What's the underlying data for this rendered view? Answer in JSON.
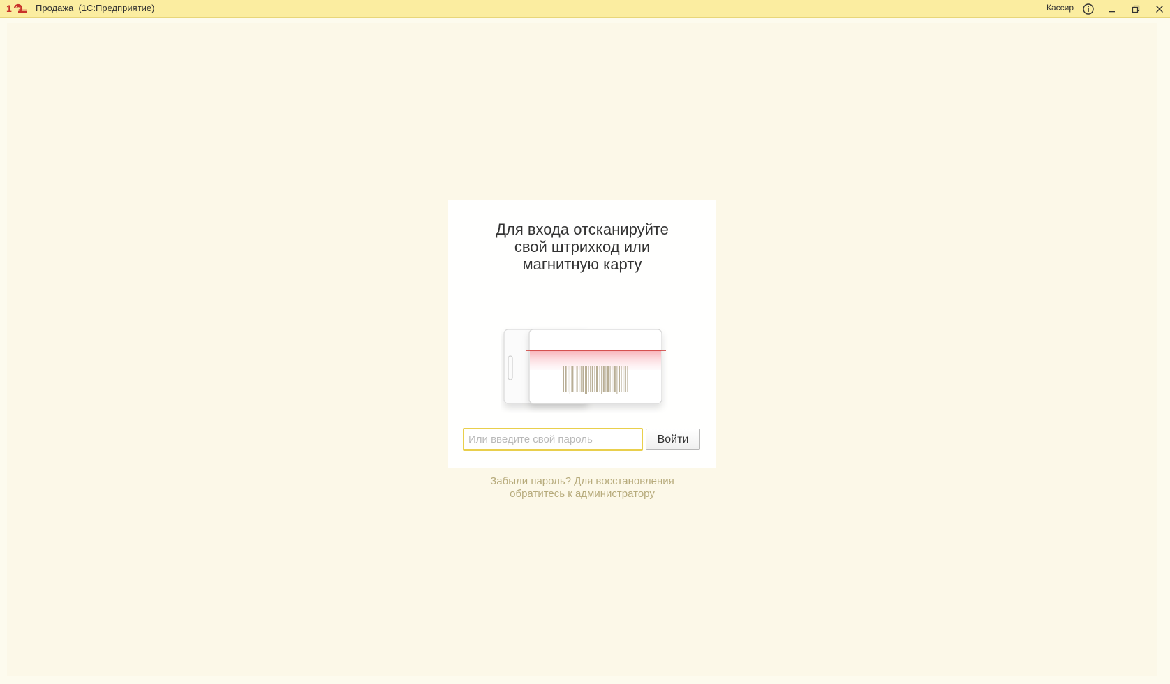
{
  "window": {
    "title": "Продажа  (1С:Предприятие)",
    "user": "Кассир",
    "icons": {
      "logo": "1c-logo-icon",
      "info": "info-icon",
      "minimize": "minimize-icon",
      "restore": "restore-icon",
      "close": "close-icon"
    }
  },
  "login": {
    "title_line1": "Для входа отсканируйте",
    "title_line2": "свой штрихкод или",
    "title_line3": "магнитную карту",
    "password_placeholder": "Или введите свой пароль",
    "password_value": "",
    "login_button": "Войти",
    "forgot_line1": "Забыли пароль? Для восстановления",
    "forgot_line2": "обратитесь к администратору",
    "illustration_icon": "barcode-card-scanner-icon"
  },
  "colors": {
    "titlebar": "#fbeda0",
    "background": "#fcf8e8",
    "accent_input_border": "#e9cf4c",
    "scan_line": "#d9534f",
    "hint_text": "#b7ab7c"
  }
}
